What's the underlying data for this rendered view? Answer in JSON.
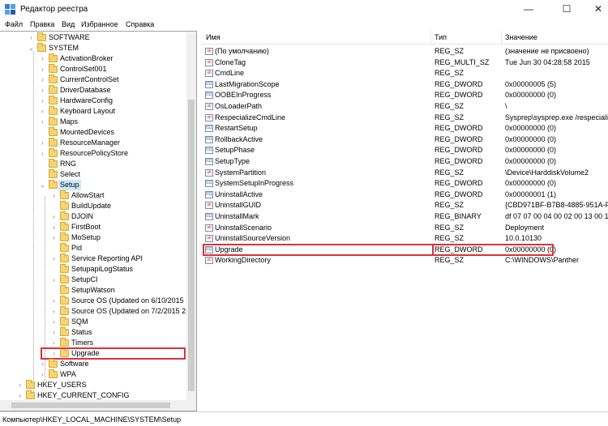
{
  "window": {
    "title": "Редактор реестра",
    "minimize": "—",
    "maximize": "☐",
    "close": "✕"
  },
  "menu": [
    "Файл",
    "Правка",
    "Вид",
    "Избранное",
    "Справка"
  ],
  "tree": [
    {
      "label": "SOFTWARE",
      "level": 0,
      "state": "collapsed"
    },
    {
      "label": "SYSTEM",
      "level": 0,
      "state": "expanded"
    },
    {
      "label": "ActivationBroker",
      "level": 1,
      "state": "collapsed"
    },
    {
      "label": "ControlSet001",
      "level": 1,
      "state": "collapsed"
    },
    {
      "label": "CurrentControlSet",
      "level": 1,
      "state": "collapsed"
    },
    {
      "label": "DriverDatabase",
      "level": 1,
      "state": "collapsed"
    },
    {
      "label": "HardwareConfig",
      "level": 1,
      "state": "collapsed"
    },
    {
      "label": "Keyboard Layout",
      "level": 1,
      "state": "collapsed"
    },
    {
      "label": "Maps",
      "level": 1,
      "state": "collapsed"
    },
    {
      "label": "MountedDevices",
      "level": 1,
      "state": "none"
    },
    {
      "label": "ResourceManager",
      "level": 1,
      "state": "collapsed"
    },
    {
      "label": "ResourcePolicyStore",
      "level": 1,
      "state": "collapsed"
    },
    {
      "label": "RNG",
      "level": 1,
      "state": "none"
    },
    {
      "label": "Select",
      "level": 1,
      "state": "none"
    },
    {
      "label": "Setup",
      "level": 1,
      "state": "expanded"
    },
    {
      "label": "AllowStart",
      "level": 2,
      "state": "collapsed"
    },
    {
      "label": "BuildUpdate",
      "level": 2,
      "state": "none"
    },
    {
      "label": "DJOIN",
      "level": 2,
      "state": "collapsed"
    },
    {
      "label": "FirstBoot",
      "level": 2,
      "state": "collapsed"
    },
    {
      "label": "MoSetup",
      "level": 2,
      "state": "collapsed"
    },
    {
      "label": "Pid",
      "level": 2,
      "state": "none"
    },
    {
      "label": "Service Reporting API",
      "level": 2,
      "state": "collapsed"
    },
    {
      "label": "SetupapiLogStatus",
      "level": 2,
      "state": "none"
    },
    {
      "label": "SetupCI",
      "level": 2,
      "state": "collapsed"
    },
    {
      "label": "SetupWatson",
      "level": 2,
      "state": "none"
    },
    {
      "label": "Source OS (Updated on 6/10/2015 19:",
      "level": 2,
      "state": "collapsed"
    },
    {
      "label": "Source OS (Updated on 7/2/2015 21:2",
      "level": 2,
      "state": "collapsed"
    },
    {
      "label": "SQM",
      "level": 2,
      "state": "collapsed"
    },
    {
      "label": "Status",
      "level": 2,
      "state": "collapsed"
    },
    {
      "label": "Timers",
      "level": 2,
      "state": "collapsed"
    },
    {
      "label": "Upgrade",
      "level": 2,
      "state": "collapsed",
      "highlight": true
    },
    {
      "label": "Software",
      "level": 1,
      "state": "collapsed"
    },
    {
      "label": "WPA",
      "level": 1,
      "state": "collapsed"
    },
    {
      "label": "HKEY_USERS",
      "level": -1,
      "state": "collapsed"
    },
    {
      "label": "HKEY_CURRENT_CONFIG",
      "level": -1,
      "state": "collapsed"
    }
  ],
  "list": {
    "headers": {
      "name": "Имя",
      "type": "Тип",
      "value": "Значение"
    },
    "rows": [
      {
        "icon": "sz",
        "name": "(По умолчанию)",
        "type": "REG_SZ",
        "value": "(значение не присвоено)"
      },
      {
        "icon": "sz",
        "name": "CloneTag",
        "type": "REG_MULTI_SZ",
        "value": "Tue Jun 30 04:28:58 2015"
      },
      {
        "icon": "sz",
        "name": "CmdLine",
        "type": "REG_SZ",
        "value": ""
      },
      {
        "icon": "bin",
        "name": "LastMigrationScope",
        "type": "REG_DWORD",
        "value": "0x00000005 (5)"
      },
      {
        "icon": "bin",
        "name": "OOBEInProgress",
        "type": "REG_DWORD",
        "value": "0x00000000 (0)"
      },
      {
        "icon": "sz",
        "name": "OsLoaderPath",
        "type": "REG_SZ",
        "value": "\\"
      },
      {
        "icon": "sz",
        "name": "RespecializeCmdLine",
        "type": "REG_SZ",
        "value": "Sysprep\\sysprep.exe /respecialize"
      },
      {
        "icon": "bin",
        "name": "RestartSetup",
        "type": "REG_DWORD",
        "value": "0x00000000 (0)"
      },
      {
        "icon": "bin",
        "name": "RollbackActive",
        "type": "REG_DWORD",
        "value": "0x00000000 (0)"
      },
      {
        "icon": "bin",
        "name": "SetupPhase",
        "type": "REG_DWORD",
        "value": "0x00000000 (0)"
      },
      {
        "icon": "bin",
        "name": "SetupType",
        "type": "REG_DWORD",
        "value": "0x00000000 (0)"
      },
      {
        "icon": "sz",
        "name": "SystemPartition",
        "type": "REG_SZ",
        "value": "\\Device\\HarddiskVolume2"
      },
      {
        "icon": "bin",
        "name": "SystemSetupInProgress",
        "type": "REG_DWORD",
        "value": "0x00000000 (0)"
      },
      {
        "icon": "bin",
        "name": "UninstallActive",
        "type": "REG_DWORD",
        "value": "0x00000001 (1)"
      },
      {
        "icon": "sz",
        "name": "UninstallGUID",
        "type": "REG_SZ",
        "value": "{CBD971BF-B7B8-4885-951A-FA0"
      },
      {
        "icon": "bin",
        "name": "UninstallMark",
        "type": "REG_BINARY",
        "value": "df 07 07 00 04 00 02 00 13 00 1a 00"
      },
      {
        "icon": "sz",
        "name": "UninstallScenario",
        "type": "REG_SZ",
        "value": "Deployment"
      },
      {
        "icon": "sz",
        "name": "UninstallSourceVersion",
        "type": "REG_SZ",
        "value": "10.0.10130"
      },
      {
        "icon": "bin",
        "name": "Upgrade",
        "type": "REG_DWORD",
        "value": "0x00000000 (0)",
        "highlight": true
      },
      {
        "icon": "sz",
        "name": "WorkingDirectory",
        "type": "REG_SZ",
        "value": "C:\\WINDOWS\\Panther"
      }
    ]
  },
  "status": "Компьютер\\HKEY_LOCAL_MACHINE\\SYSTEM\\Setup",
  "colors": {
    "highlight": "#d9323a",
    "folder": "#f5d473"
  }
}
